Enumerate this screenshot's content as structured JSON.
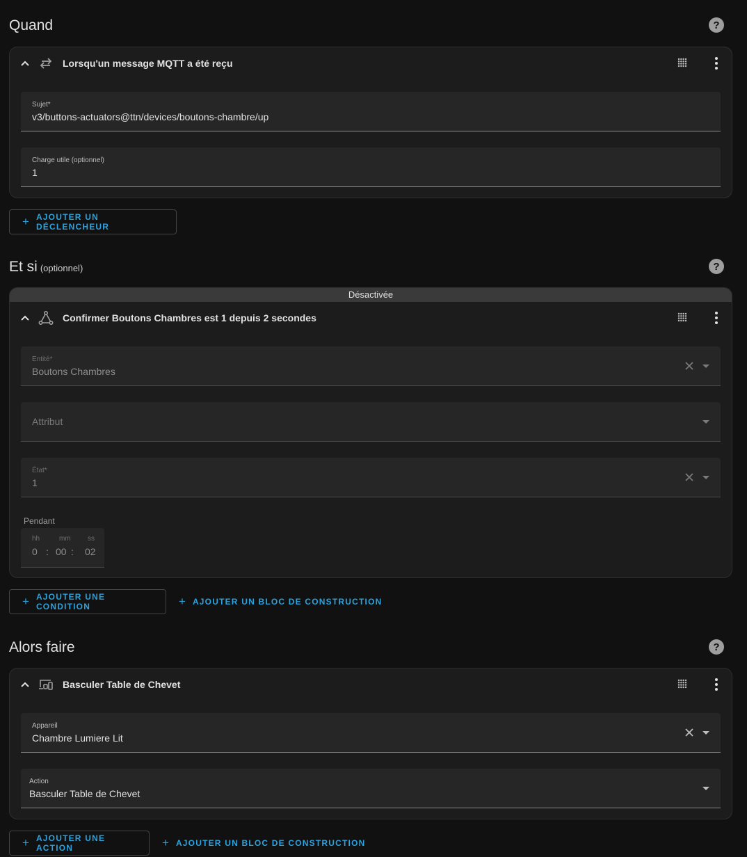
{
  "help_symbol": "?",
  "triggers": {
    "title": "Quand",
    "card": {
      "title": "Lorsqu'un message MQTT a été reçu",
      "icon": "swap-horizontal-icon",
      "fields": {
        "topic_label": "Sujet*",
        "topic_value": "v3/buttons-actuators@ttn/devices/boutons-chambre/up",
        "payload_label": "Charge utile (optionnel)",
        "payload_value": "1"
      }
    },
    "add_button": "Ajouter un déclencheur"
  },
  "conditions": {
    "title": "Et si",
    "optional": "(optionnel)",
    "card": {
      "banner": "Désactivée",
      "title": "Confirmer Boutons Chambres est 1 depuis 2 secondes",
      "icon": "state-graph-icon",
      "entity_label": "Entité*",
      "entity_value": "Boutons Chambres",
      "attribute_placeholder": "Attribut",
      "state_label": "État*",
      "state_value": "1",
      "duration_label": "Pendant",
      "duration": {
        "hh_label": "hh",
        "mm_label": "mm",
        "ss_label": "ss",
        "hh": "0",
        "mm": "00",
        "ss": "02",
        "sep": ":"
      }
    },
    "add_button": "Ajouter une condition",
    "add_block_button": "Ajouter un bloc de construction"
  },
  "actions": {
    "title": "Alors faire",
    "card": {
      "title": "Basculer Table de Chevet",
      "icon": "devices-icon",
      "device_label": "Appareil",
      "device_value": "Chambre Lumiere Lit",
      "action_label": "Action",
      "action_value": "Basculer Table de Chevet"
    },
    "add_button": "Ajouter une action",
    "add_block_button": "Ajouter un bloc de construction"
  },
  "plus_symbol": "+",
  "colors": {
    "accent": "#2aa3e0",
    "background": "#111111",
    "card": "#1c1c1c",
    "field": "#262626"
  }
}
